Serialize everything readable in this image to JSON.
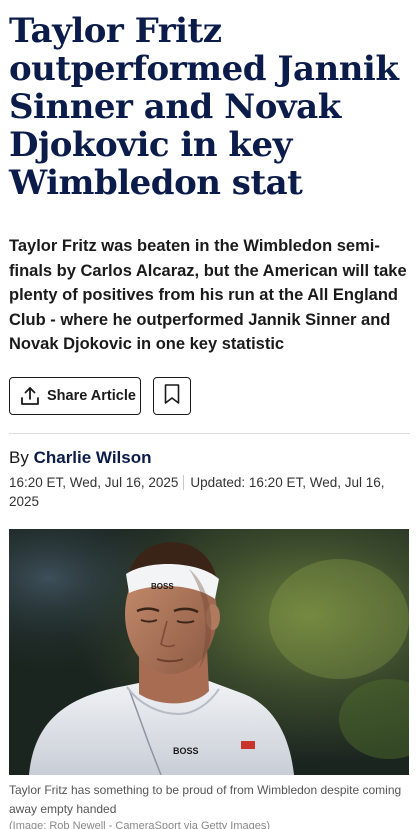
{
  "article": {
    "headline": "Taylor Fritz outperformed Jannik Sinner and Novak Djokovic in key Wimbledon stat",
    "standfirst": "Taylor Fritz was beaten in the Wimbledon semi-finals by Carlos Alcaraz, but the American will take plenty of positives from his run at the All England Club - where he outperformed Jannik Sinner and Novak Djokovic in one key statistic",
    "share_label": "Share Article",
    "byline_prefix": "By",
    "author": "Charlie Wilson",
    "published": "16:20 ET, Wed, Jul 16, 2025",
    "updated": "Updated: 16:20 ET, Wed, Jul 16, 2025",
    "image": {
      "headband_text": "BOSS",
      "shirt_text": "BOSS",
      "caption": "Taylor Fritz has something to be proud of from Wimbledon despite coming away empty handed",
      "credit": "(Image: Rob Newell - CameraSport via Getty Images)"
    }
  },
  "icons": {
    "share": "share-upload-icon",
    "bookmark": "bookmark-icon"
  },
  "colors": {
    "headline": "#0b1c4a",
    "author": "#0b1c4a",
    "text": "#1a1a1a"
  }
}
